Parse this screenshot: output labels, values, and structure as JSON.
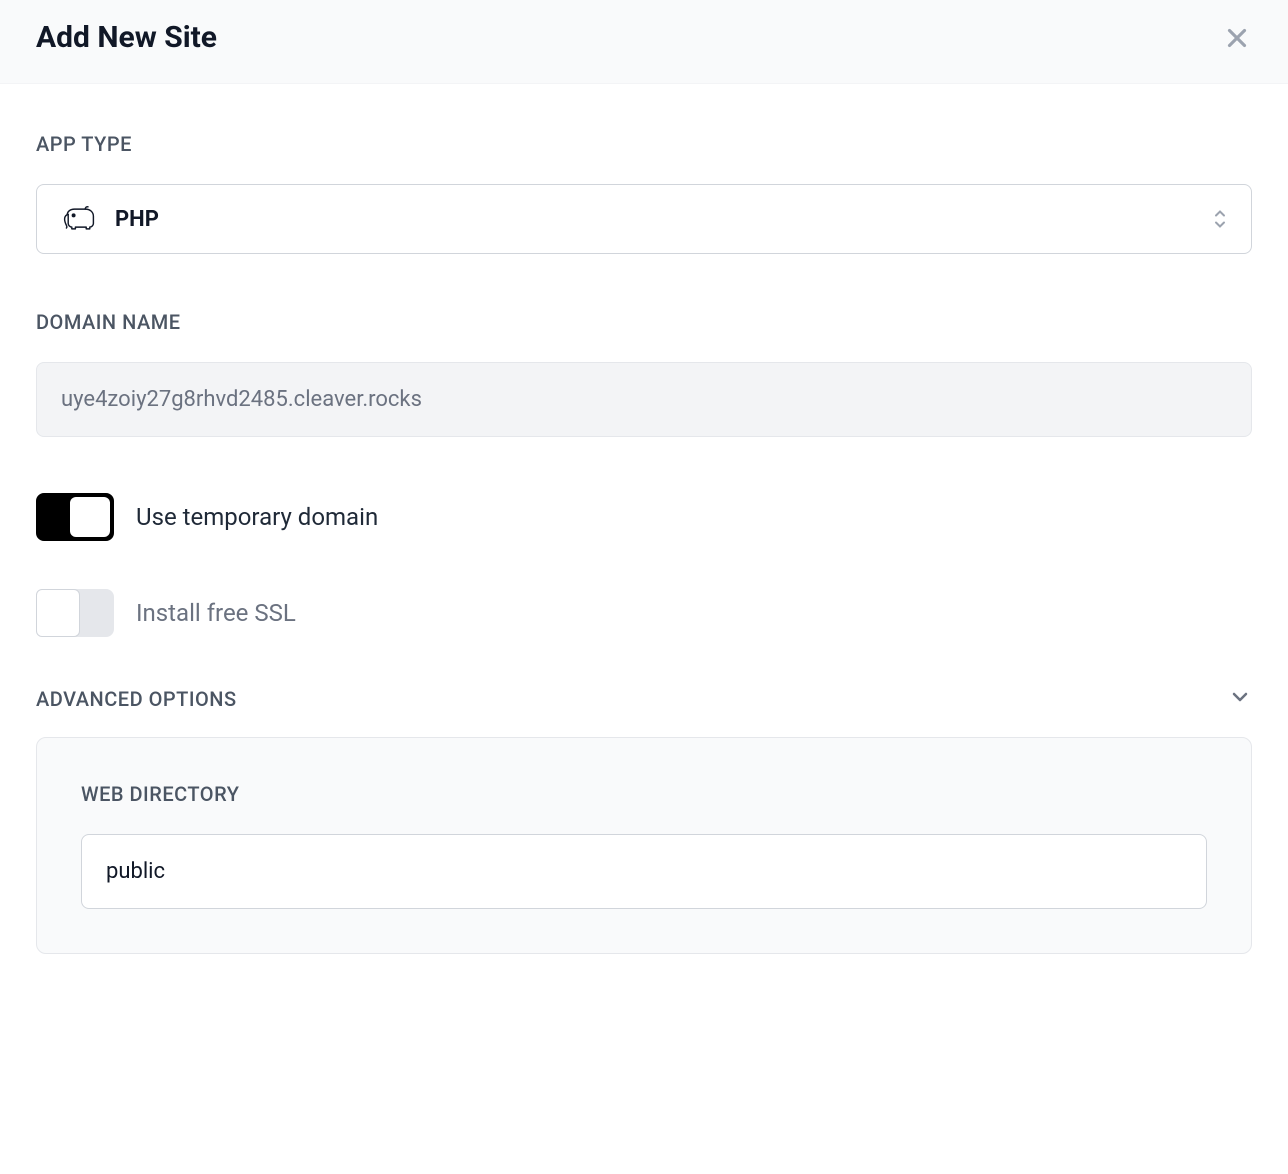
{
  "header": {
    "title": "Add New Site"
  },
  "form": {
    "app_type": {
      "label": "APP TYPE",
      "selected": "PHP"
    },
    "domain_name": {
      "label": "DOMAIN NAME",
      "value": "uye4zoiy27g8rhvd2485.cleaver.rocks"
    },
    "temp_domain": {
      "label": "Use temporary domain",
      "enabled": true
    },
    "ssl": {
      "label": "Install free SSL",
      "enabled": false
    },
    "advanced": {
      "label": "ADVANCED OPTIONS",
      "web_directory": {
        "label": "WEB DIRECTORY",
        "value": "public"
      }
    }
  }
}
